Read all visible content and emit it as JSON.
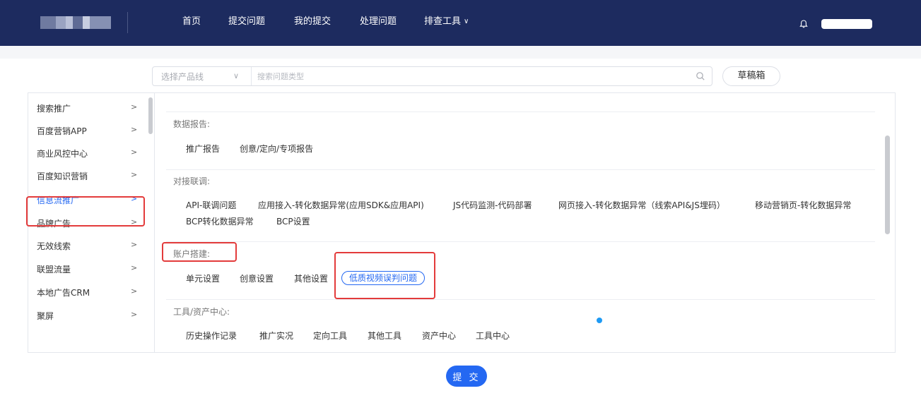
{
  "nav": {
    "items": [
      "首页",
      "提交问题",
      "我的提交",
      "处理问题",
      "排查工具"
    ],
    "tools_chevron": "∨"
  },
  "search": {
    "product_placeholder": "选择产品线",
    "type_placeholder": "搜索问题类型"
  },
  "draft_label": "草稿箱",
  "sidebar": {
    "items": [
      {
        "label": "搜索推广"
      },
      {
        "label": "百度营销APP"
      },
      {
        "label": "商业风控中心"
      },
      {
        "label": "百度知识营销"
      },
      {
        "label": "信息流推广"
      },
      {
        "label": "品牌广告"
      },
      {
        "label": "无效线索"
      },
      {
        "label": "联盟流量"
      },
      {
        "label": "本地广告CRM"
      },
      {
        "label": "聚屏"
      }
    ],
    "active_index": 4,
    "arrow": ">"
  },
  "sections": [
    {
      "title": "数据报告:",
      "options": [
        "推广报告",
        "创意/定向/专项报告"
      ]
    },
    {
      "title": "对接联调:",
      "options": [
        "API-联调问题",
        "应用接入-转化数据异常(应用SDK&应用API)",
        "JS代码监测-代码部署",
        "网页接入-转化数据异常（线索API&JS埋码）",
        "移动营销页-转化数据异常",
        "BCP转化数据异常",
        "BCP设置"
      ]
    },
    {
      "title": "账户搭建:",
      "options": [
        "单元设置",
        "创意设置",
        "其他设置",
        "低质视频误判问题"
      ],
      "selected": "低质视频误判问题"
    },
    {
      "title": "工具/资产中心:",
      "options": [
        "历史操作记录",
        "推广实况",
        "定向工具",
        "其他工具",
        "资产中心",
        "工具中心"
      ]
    }
  ],
  "submit_label": "提 交",
  "colors": {
    "topbar": "#1d2b5f",
    "accent": "#2468f2",
    "highlight": "#e33b3b",
    "dot": "#1e9af4"
  }
}
